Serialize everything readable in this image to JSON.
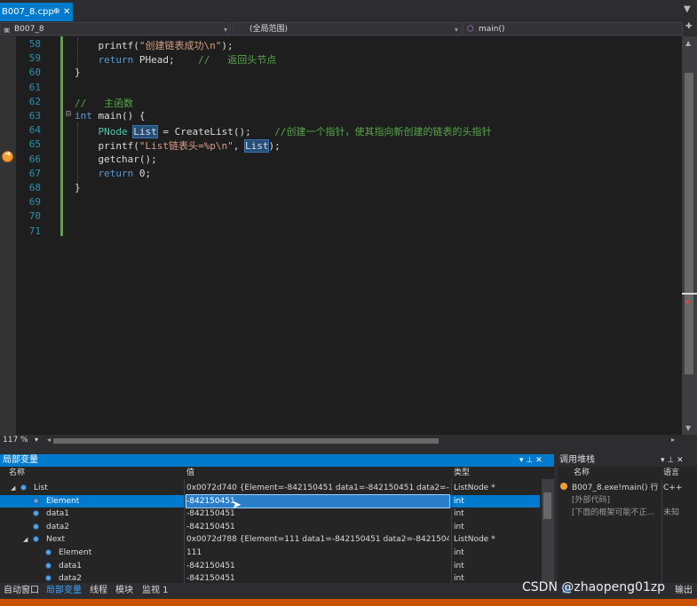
{
  "tab": {
    "file": "B007_8.cpp",
    "pin": "⊕",
    "close": "✕"
  },
  "nav": {
    "project": "B007_8",
    "scope": "(全局范围)",
    "func": "main()"
  },
  "code_lines": [
    {
      "n": "58",
      "t": "    printf(\"创建链表成功\\n\");"
    },
    {
      "n": "59",
      "t": "    return PHead;    //   返回头节点"
    },
    {
      "n": "60",
      "t": "}"
    },
    {
      "n": "61",
      "t": ""
    },
    {
      "n": "62",
      "t": "//   主函数"
    },
    {
      "n": "63",
      "t": "int main() {"
    },
    {
      "n": "64",
      "t": "    PNode List = CreateList();    //创建一个指针，使其指向新创建的链表的头指针"
    },
    {
      "n": "65",
      "t": "    printf(\"List链表头=%p\\n\", List);"
    },
    {
      "n": "66",
      "t": "    getchar();"
    },
    {
      "n": "67",
      "t": "    return 0;"
    },
    {
      "n": "68",
      "t": "}"
    },
    {
      "n": "69",
      "t": ""
    },
    {
      "n": "70",
      "t": ""
    },
    {
      "n": "71",
      "t": ""
    }
  ],
  "zoom": "117 %",
  "locals": {
    "title": "局部变量",
    "header_buttons": "▾ ⊥ ✕",
    "columns": [
      "名称",
      "值",
      "类型"
    ],
    "rows": [
      {
        "name": "List",
        "value": "0x0072d740 {Element=-842150451 data1=-842150451 data2=-84215...",
        "type": "ListNode *",
        "indent": 0,
        "expand": "◢"
      },
      {
        "name": "Element",
        "value": "-842150451",
        "type": "int",
        "indent": 1,
        "expand": ""
      },
      {
        "name": "data1",
        "value": "-842150451",
        "type": "int",
        "indent": 1,
        "expand": ""
      },
      {
        "name": "data2",
        "value": "-842150451",
        "type": "int",
        "indent": 1,
        "expand": ""
      },
      {
        "name": "Next",
        "value": "0x0072d788 {Element=111 data1=-842150451 data2=-842150451 ...}",
        "type": "ListNode *",
        "indent": 1,
        "expand": "◢"
      },
      {
        "name": "Element",
        "value": "111",
        "type": "int",
        "indent": 2,
        "expand": ""
      },
      {
        "name": "data1",
        "value": "-842150451",
        "type": "int",
        "indent": 2,
        "expand": ""
      },
      {
        "name": "data2",
        "value": "-842150451",
        "type": "int",
        "indent": 2,
        "expand": ""
      }
    ]
  },
  "callstack": {
    "title": "调用堆栈",
    "header_buttons": "▾ ⊥ ✕",
    "columns": [
      "名称",
      "语言"
    ],
    "rows": [
      {
        "name": "B007_8.exe!main() 行 ...",
        "lang": "C++"
      },
      {
        "name": "[外部代码]",
        "lang": ""
      },
      {
        "name": "[下面的框架可能不正...",
        "lang": "未知"
      }
    ]
  },
  "bottom_tabs": [
    "自动窗口",
    "局部变量",
    "线程",
    "模块",
    "监视 1"
  ],
  "bottom_tabs_right": [
    "调",
    "输出"
  ],
  "watermark": "CSDN @zhaopeng01zp"
}
